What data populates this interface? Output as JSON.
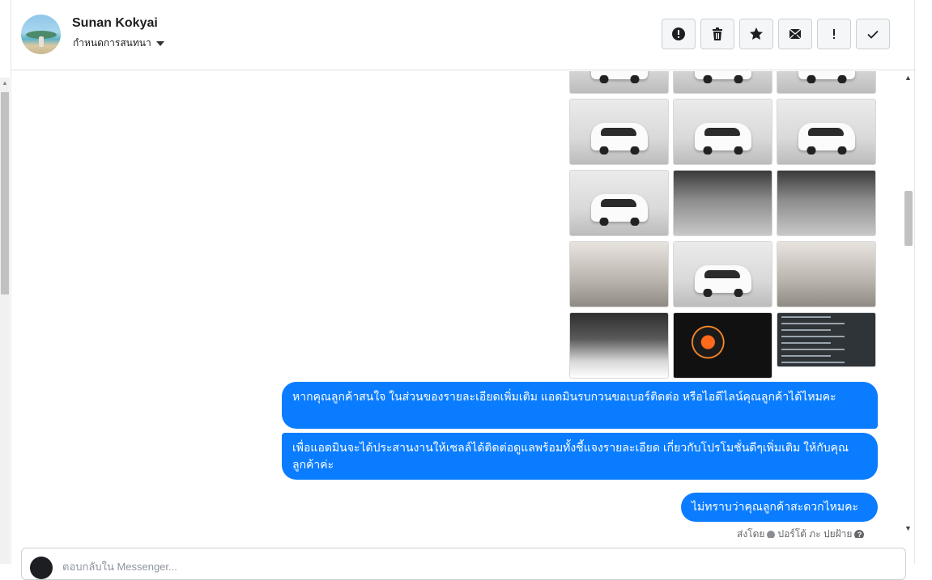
{
  "header": {
    "name": "Sunan Kokyai",
    "subtitle": "กำหนดการสนทนา"
  },
  "toolbar": [
    {
      "icon": "alert-circle-icon"
    },
    {
      "icon": "trash-icon"
    },
    {
      "icon": "star-icon"
    },
    {
      "icon": "mark-unread-icon"
    },
    {
      "icon": "exclamation-icon"
    },
    {
      "icon": "checkmark-icon"
    }
  ],
  "thread": {
    "photos": [
      {
        "kind": "studio",
        "desc": "car-rear"
      },
      {
        "kind": "studio",
        "desc": "car-rear"
      },
      {
        "kind": "studio",
        "desc": "car-rear"
      },
      {
        "kind": "studio",
        "desc": "car-rear"
      },
      {
        "kind": "studio",
        "desc": "car-rear-quarter"
      },
      {
        "kind": "studio",
        "desc": "car-side"
      },
      {
        "kind": "studio",
        "desc": "car-side"
      },
      {
        "kind": "interior",
        "desc": "dashboard"
      },
      {
        "kind": "interior",
        "desc": "gear-console"
      },
      {
        "kind": "seat",
        "desc": "rear-seats"
      },
      {
        "kind": "studio",
        "desc": "wheel"
      },
      {
        "kind": "seat",
        "desc": "door-panel"
      },
      {
        "kind": "engine",
        "desc": "engine-bay"
      },
      {
        "kind": "dash",
        "desc": "gauge-cluster"
      },
      {
        "kind": "doc",
        "desc": "spec-sheet"
      }
    ],
    "messages": [
      {
        "text": "หากคุณลูกค้าสนใจ ในส่วนของรายละเอียดเพิ่มเติม แอดมินรบกวนขอเบอร์ติดต่อ หรือไอดีไลน์คุณลูกค้าได้ไหมคะ"
      },
      {
        "text": "เพื่อแอดมินจะได้ประสานงานให้เซลล์ได้ติดต่อดูแลพร้อมทั้งชี้แจงรายละเอียด เกี่ยวกับโปรโมชั่นดีๆเพิ่มเติม ให้กับคุณลูกค้าค่ะ"
      },
      {
        "text": "ไม่ทราบว่าคุณลูกค้าสะดวกไหมคะ"
      }
    ],
    "sent_by_prefix": "ส่งโดย",
    "sent_by_name": "ปอร์โต้ ภะ ปุยฝ้าย",
    "help_glyph": "?"
  },
  "composer": {
    "placeholder": "ตอบกลับใน Messenger..."
  },
  "colors": {
    "bubble": "#0a7cff",
    "toolbar_bg": "#f5f6f7"
  }
}
